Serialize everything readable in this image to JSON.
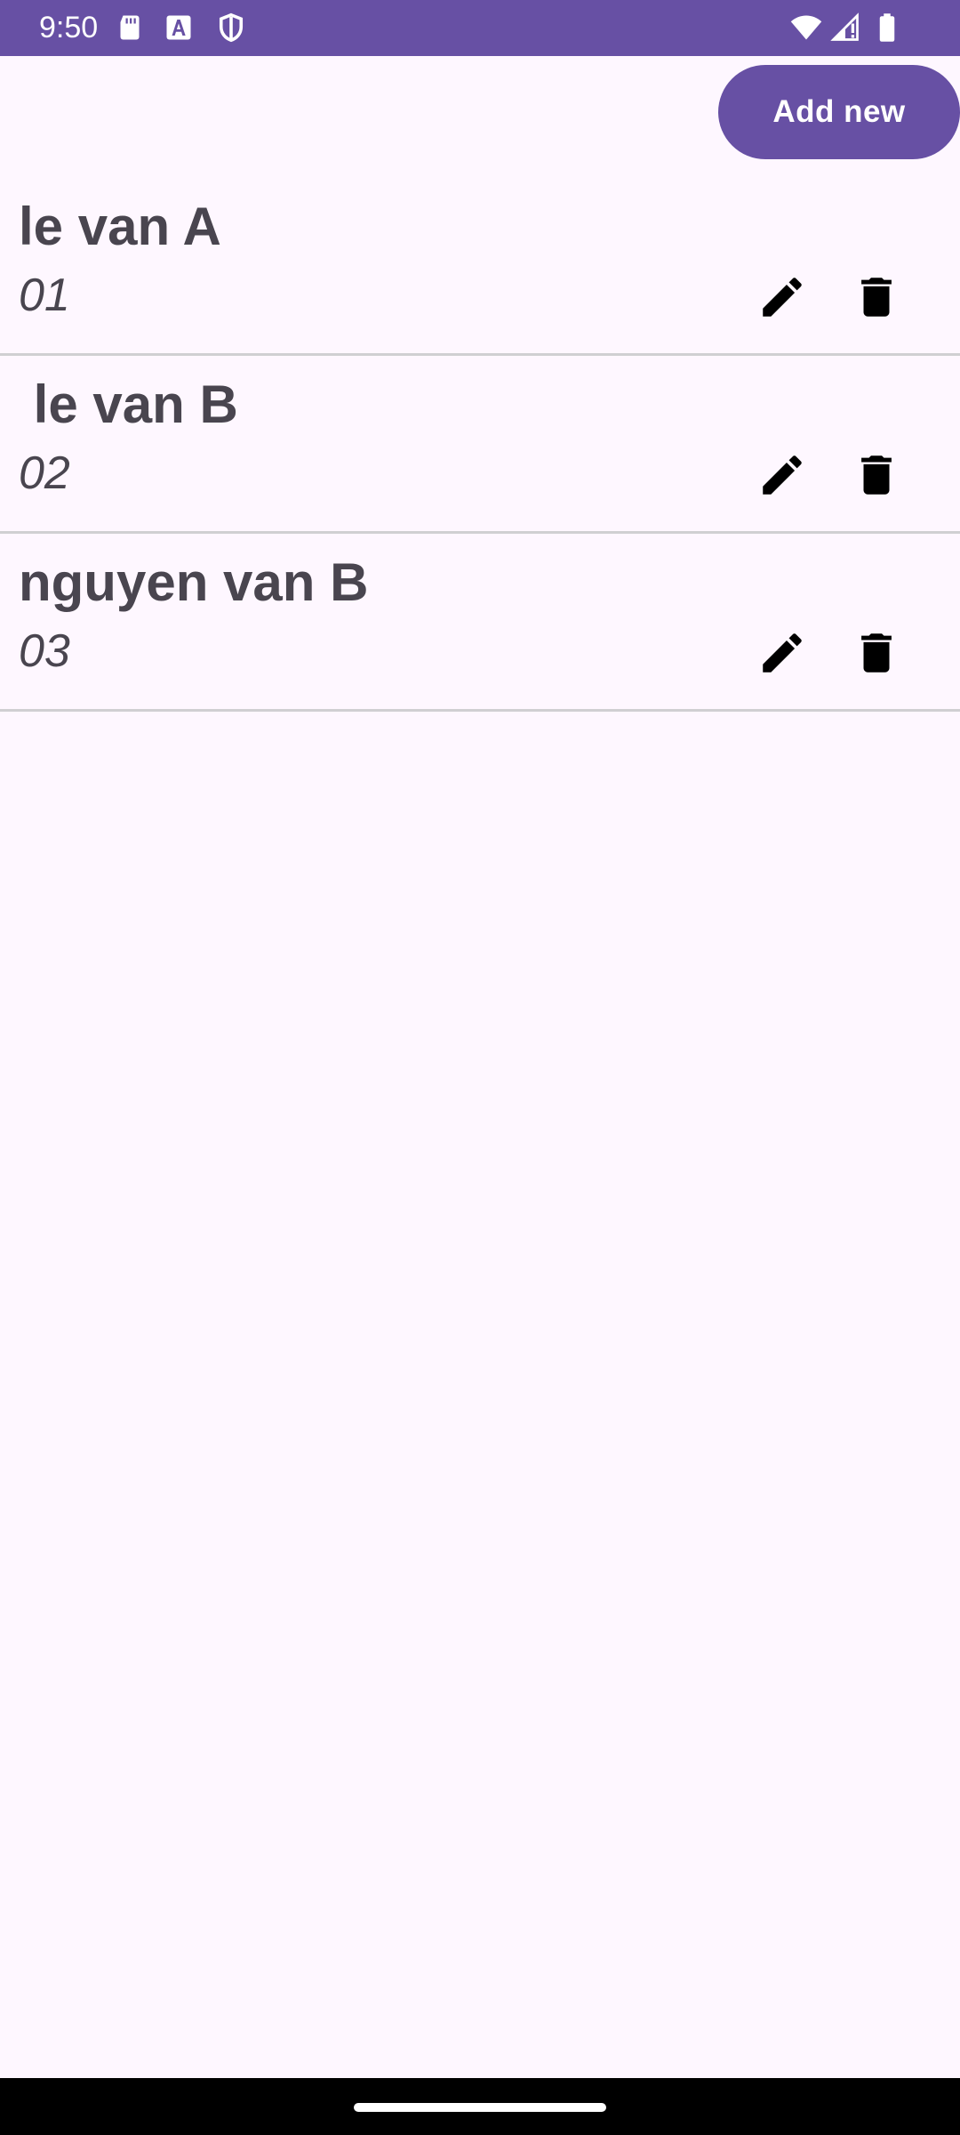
{
  "status_bar": {
    "time": "9:50",
    "background": "#6750A4",
    "icons_left": [
      "sd-card-icon",
      "text-a-icon",
      "shield-icon"
    ],
    "icons_right": [
      "wifi-icon",
      "signal-icon",
      "battery-icon"
    ]
  },
  "toolbar": {
    "add_label": "Add new"
  },
  "items": [
    {
      "name": "le van A",
      "code": "01"
    },
    {
      "name": " le van B",
      "code": "02"
    },
    {
      "name": "nguyen van B",
      "code": "03"
    }
  ],
  "colors": {
    "accent": "#6750A4",
    "background": "#FEF7FF",
    "text": "#49454F",
    "divider": "#D0CFD2"
  }
}
